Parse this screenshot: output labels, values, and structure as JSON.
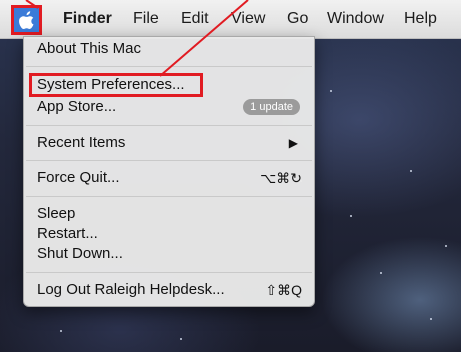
{
  "menubar": {
    "apple_menu": "apple-icon",
    "items": [
      "Finder",
      "File",
      "Edit",
      "View",
      "Go",
      "Window",
      "Help"
    ]
  },
  "apple_menu": {
    "about": "About This Mac",
    "system_preferences": "System Preferences...",
    "app_store": "App Store...",
    "app_store_badge": "1 update",
    "recent_items": "Recent Items",
    "force_quit": "Force Quit...",
    "force_quit_shortcut": "⌥⌘↻",
    "sleep": "Sleep",
    "restart": "Restart...",
    "shut_down": "Shut Down...",
    "log_out": "Log Out Raleigh Helpdesk...",
    "log_out_shortcut": "⇧⌘Q"
  },
  "annotation_color": "#e11b22"
}
